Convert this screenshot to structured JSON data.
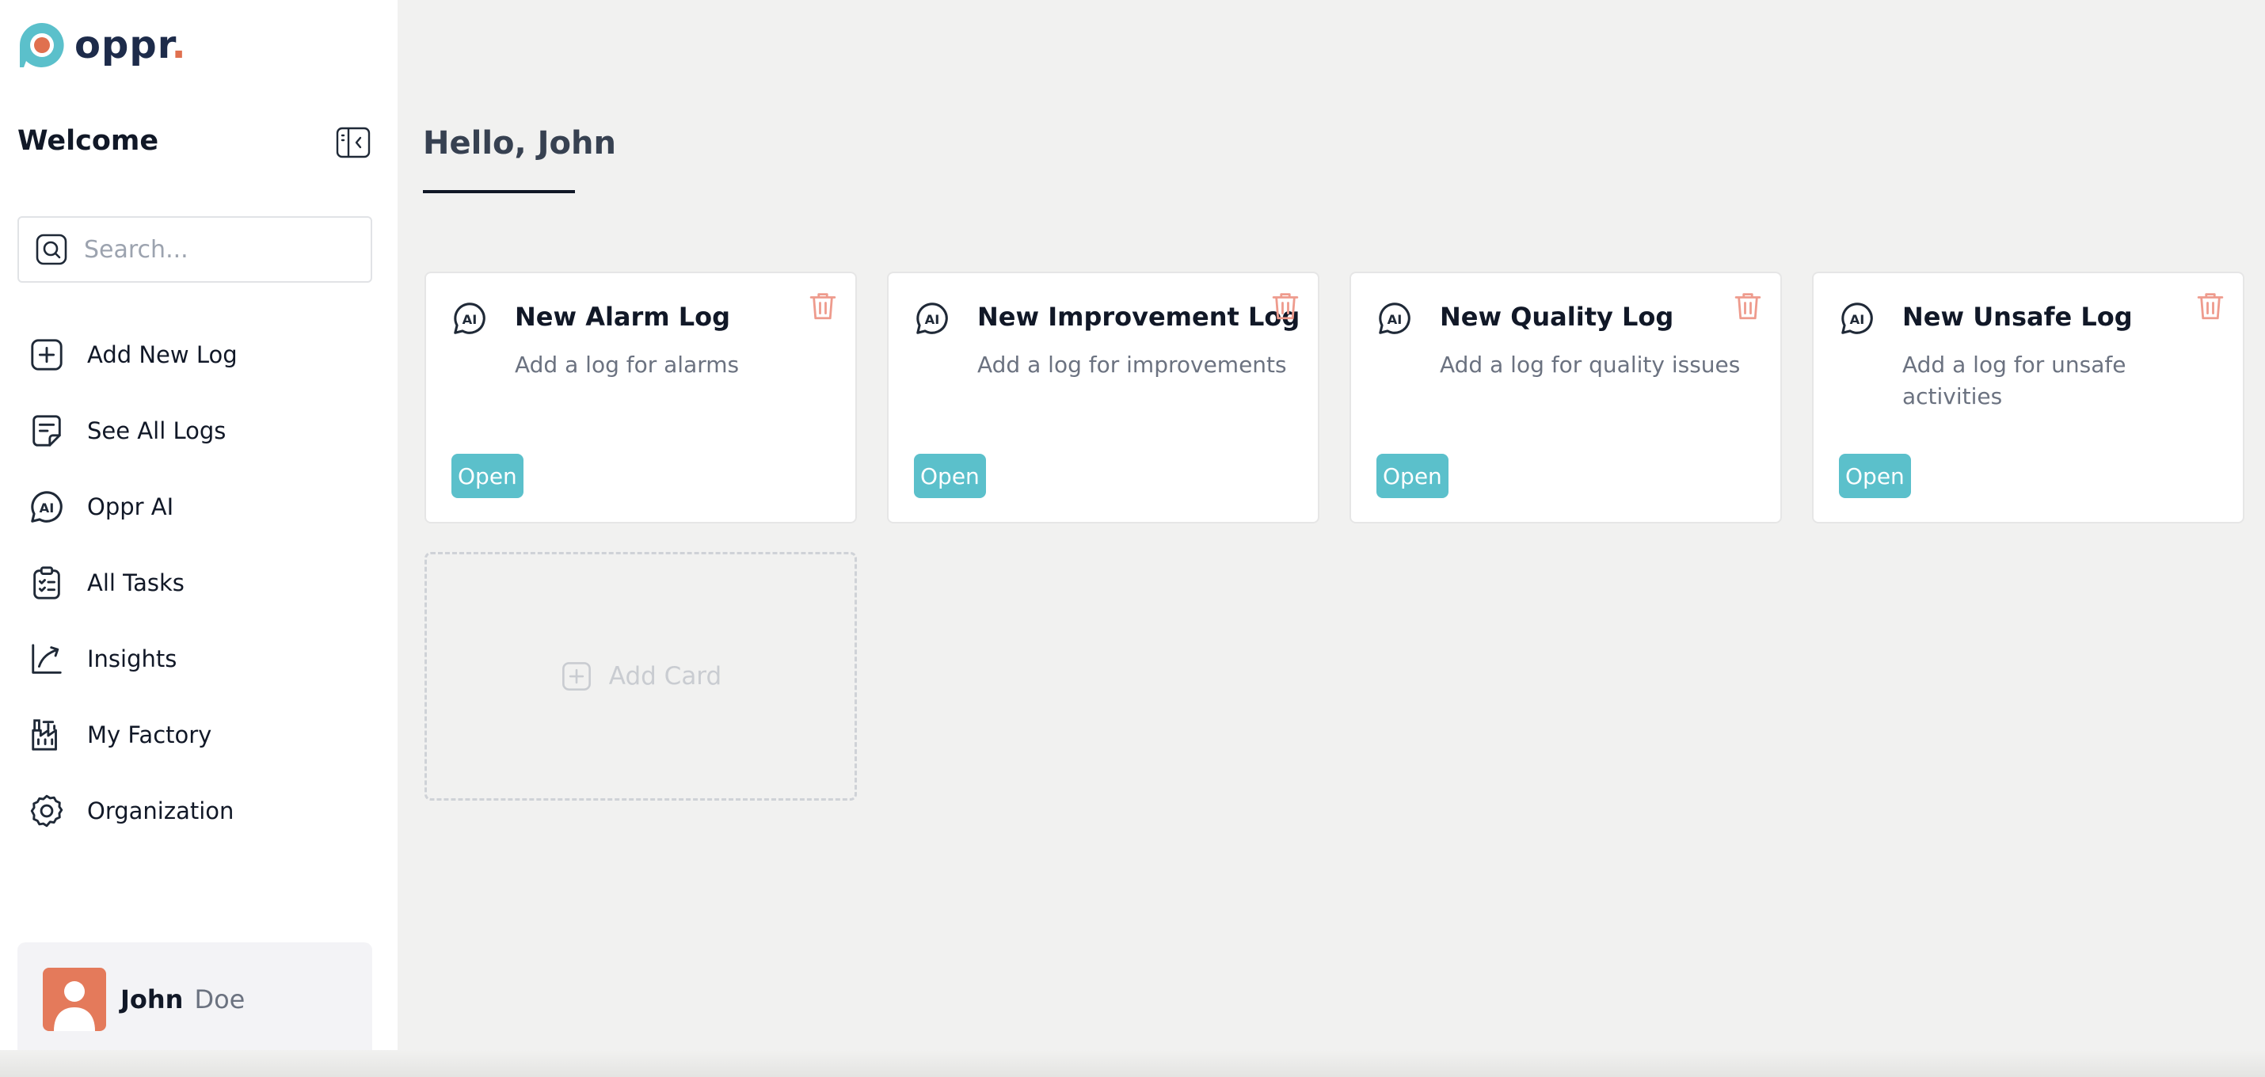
{
  "app": {
    "logo_text": "oppr",
    "logo_dot": ".",
    "brand_colors": {
      "teal": "#5bc0cb",
      "orange": "#e0704f",
      "navy": "#1d2b4a"
    }
  },
  "sidebar": {
    "title": "Welcome",
    "search": {
      "placeholder": "Search...",
      "value": ""
    },
    "items": [
      {
        "label": "Add New Log",
        "icon": "plus-square-icon"
      },
      {
        "label": "See All Logs",
        "icon": "document-icon"
      },
      {
        "label": "Oppr AI",
        "icon": "ai-chat-icon"
      },
      {
        "label": "All Tasks",
        "icon": "clipboard-checklist-icon"
      },
      {
        "label": "Insights",
        "icon": "trend-arrow-icon"
      },
      {
        "label": "My Factory",
        "icon": "factory-icon"
      },
      {
        "label": "Organization",
        "icon": "gear-icon"
      }
    ],
    "user": {
      "first_name": "John",
      "last_name": "Doe"
    }
  },
  "main": {
    "greeting": "Hello, John",
    "cards": [
      {
        "title": "New Alarm Log",
        "description": "Add a log for alarms",
        "button": "Open"
      },
      {
        "title": "New Improvement Log",
        "description": "Add a log for improvements",
        "button": "Open"
      },
      {
        "title": "New Quality Log",
        "description": "Add a log for quality issues",
        "button": "Open"
      },
      {
        "title": "New Unsafe Log",
        "description": "Add a log for unsafe activities",
        "button": "Open"
      }
    ],
    "add_card_label": "Add Card"
  }
}
